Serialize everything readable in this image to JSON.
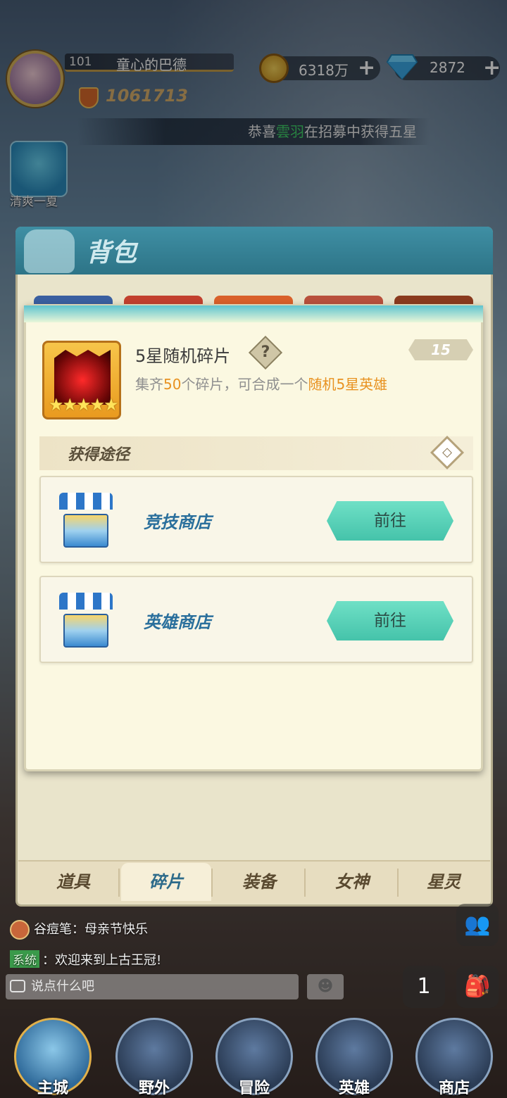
{
  "player": {
    "level": "101",
    "name": "童心的巴德",
    "power": "1061713"
  },
  "currency": {
    "gold": "6318万",
    "diamonds": "2872"
  },
  "broadcast": {
    "prefix": "恭喜",
    "hero": "雲羽",
    "suffix": "在招募中获得五星"
  },
  "event": {
    "label": "清爽一夏"
  },
  "bag": {
    "title": "背包",
    "tabs": [
      "道具",
      "碎片",
      "装备",
      "女神",
      "星灵"
    ],
    "active_tab": "碎片"
  },
  "item": {
    "name": "5星随机碎片",
    "count": "15",
    "help_icon": "?",
    "desc_prefix": "集齐",
    "desc_num": "50",
    "desc_mid": "个碎片，可合成一个",
    "desc_target": "随机5星英雄",
    "stars": "★★★★★"
  },
  "sources": {
    "title": "获得途径",
    "collapse_icon": "◇",
    "items": [
      {
        "name": "竞技商店",
        "button": "前往"
      },
      {
        "name": "英雄商店",
        "button": "前往"
      }
    ]
  },
  "chat": {
    "line1_user": "谷痘笔",
    "line1_text": "：母亲节快乐",
    "system_tag": "系统",
    "system_text": "：欢迎来到上古王冠!",
    "placeholder": "说点什么吧",
    "emoji": "☻"
  },
  "nav": {
    "items": [
      "主城",
      "野外",
      "冒险",
      "英雄",
      "商店"
    ]
  },
  "colors": {
    "accent_teal": "#45c3aa",
    "highlight_orange": "#e89221",
    "broadcast_green": "#41d36a"
  }
}
